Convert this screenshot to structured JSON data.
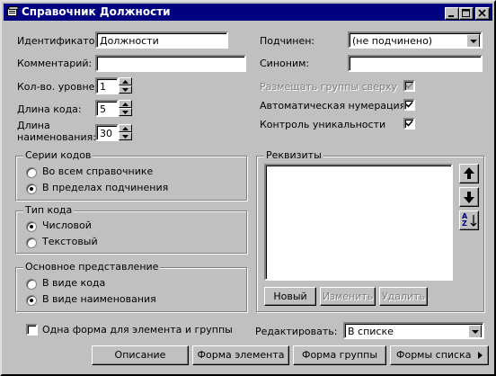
{
  "window": {
    "title": "Справочник Должности",
    "minimize": "_",
    "maximize": "□",
    "close": "×"
  },
  "left": {
    "identifier_label": "Идентификатор:",
    "identifier_value": "Должности",
    "comment_label": "Комментарий:",
    "comment_value": "",
    "levels_label": "Кол-во. уровней:",
    "levels_value": "1",
    "code_length_label": "Длина кода:",
    "code_length_value": "5",
    "name_length_label_1": "Длина",
    "name_length_label_2": "наименования:",
    "name_length_value": "30"
  },
  "right": {
    "subordinate_label": "Подчинен:",
    "subordinate_value": "(не подчинено)",
    "synonym_label": "Синоним:",
    "synonym_value": "",
    "groups_top_label": "Размещать группы сверху",
    "auto_numbering_label": "Автоматическая нумерация",
    "uniqueness_label": "Контроль уникальности"
  },
  "code_series": {
    "title": "Серии кодов",
    "options": [
      "Во всем справочнике",
      "В пределах подчинения"
    ],
    "selected": 1
  },
  "code_type": {
    "title": "Тип кода",
    "options": [
      "Числовой",
      "Текстовый"
    ],
    "selected": 0
  },
  "main_view": {
    "title": "Основное представление",
    "options": [
      "В виде кода",
      "В виде наименования"
    ],
    "selected": 1
  },
  "requisites": {
    "title": "Реквизиты",
    "new_button": "Новый",
    "edit_button": "Изменить",
    "delete_button": "Удалить",
    "sort_label": "A Z"
  },
  "bottom": {
    "one_form_label": "Одна форма для элемента и группы",
    "edit_label": "Редактировать:",
    "edit_value": "В списке",
    "buttons": [
      "Описание",
      "Форма элемента",
      "Форма группы",
      "Формы списка"
    ]
  }
}
